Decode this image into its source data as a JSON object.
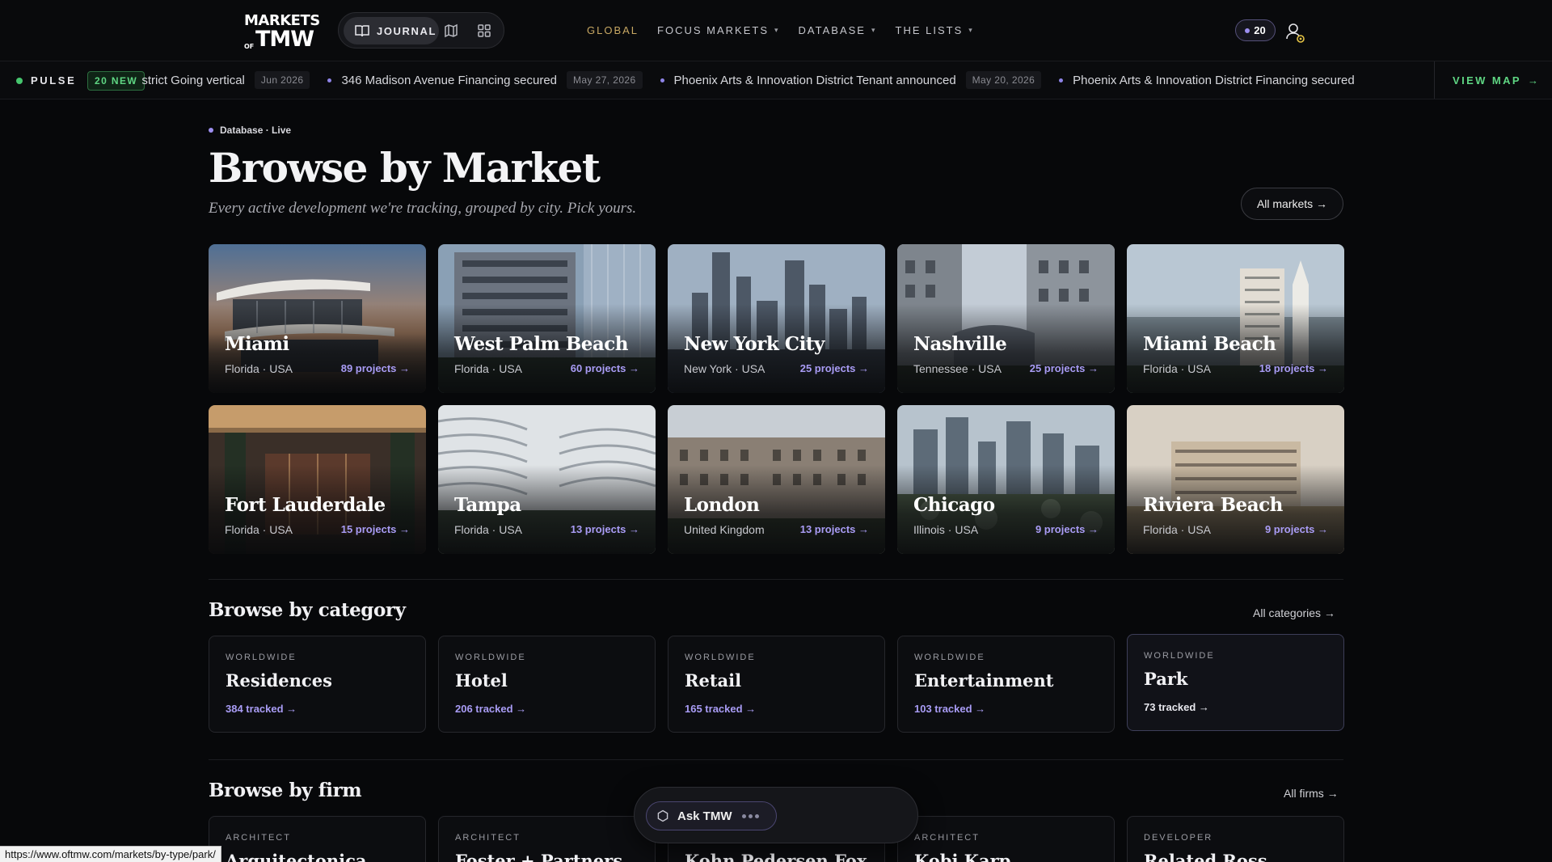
{
  "nav": {
    "logo_line1": "MARKETS",
    "logo_of": "OF",
    "logo_tmw": "TMW",
    "journal_label": "JOURNAL",
    "links": [
      {
        "label": "GLOBAL",
        "active": true
      },
      {
        "label": "FOCUS MARKETS",
        "dropdown": true
      },
      {
        "label": "DATABASE",
        "dropdown": true
      },
      {
        "label": "THE LISTS",
        "dropdown": true
      }
    ],
    "notif_count": "20"
  },
  "pulse": {
    "label": "PULSE",
    "new_badge": "20 NEW",
    "items": [
      {
        "text": "istrict Going vertical",
        "date": "Jun 2026"
      },
      {
        "text": "346 Madison Avenue Financing secured",
        "date": "May 27, 2026"
      },
      {
        "text": "Phoenix Arts & Innovation District Tenant announced",
        "date": "May 20, 2026"
      },
      {
        "text": "Phoenix Arts & Innovation District Financing secured",
        "date": ""
      }
    ],
    "view_map": "VIEW MAP"
  },
  "header": {
    "status": "Database · Live",
    "title": "Browse by Market",
    "subtitle": "Every active development we're tracking, grouped by city. Pick yours.",
    "all_markets": "All markets →"
  },
  "markets": [
    {
      "name": "Miami",
      "location": "Florida · USA",
      "projects": "89 projects →"
    },
    {
      "name": "West Palm Beach",
      "location": "Florida · USA",
      "projects": "60 projects →"
    },
    {
      "name": "New York City",
      "location": "New York · USA",
      "projects": "25 projects →"
    },
    {
      "name": "Nashville",
      "location": "Tennessee · USA",
      "projects": "25 projects →"
    },
    {
      "name": "Miami Beach",
      "location": "Florida · USA",
      "projects": "18 projects →"
    },
    {
      "name": "Fort Lauderdale",
      "location": "Florida · USA",
      "projects": "15 projects →"
    },
    {
      "name": "Tampa",
      "location": "Florida · USA",
      "projects": "13 projects →"
    },
    {
      "name": "London",
      "location": "United Kingdom",
      "projects": "13 projects →"
    },
    {
      "name": "Chicago",
      "location": "Illinois · USA",
      "projects": "9 projects →"
    },
    {
      "name": "Riviera Beach",
      "location": "Florida · USA",
      "projects": "9 projects →"
    }
  ],
  "categories": {
    "title": "Browse by category",
    "all_link": "All categories →",
    "items": [
      {
        "scope": "WORLDWIDE",
        "name": "Residences",
        "tracked": "384 tracked →"
      },
      {
        "scope": "WORLDWIDE",
        "name": "Hotel",
        "tracked": "206 tracked →"
      },
      {
        "scope": "WORLDWIDE",
        "name": "Retail",
        "tracked": "165 tracked →"
      },
      {
        "scope": "WORLDWIDE",
        "name": "Entertainment",
        "tracked": "103 tracked →"
      },
      {
        "scope": "WORLDWIDE",
        "name": "Park",
        "tracked": "73 tracked →"
      }
    ]
  },
  "firms": {
    "title": "Browse by firm",
    "all_link": "All firms →",
    "items": [
      {
        "role": "ARCHITECT",
        "name": "Arquitectonica"
      },
      {
        "role": "ARCHITECT",
        "name": "Foster + Partners"
      },
      {
        "role": "ARCHITECT",
        "name": "Kohn Pedersen Fox"
      },
      {
        "role": "ARCHITECT",
        "name": "Kobi Karp"
      },
      {
        "role": "DEVELOPER",
        "name": "Related Ross"
      }
    ]
  },
  "assistant": {
    "label": "Ask TMW"
  },
  "status_url": "https://www.oftmw.com/markets/by-type/park/",
  "colors": {
    "accent": "#a99cf5",
    "gold": "#c8a863",
    "live_green": "#5fd683",
    "background": "#07080a"
  }
}
